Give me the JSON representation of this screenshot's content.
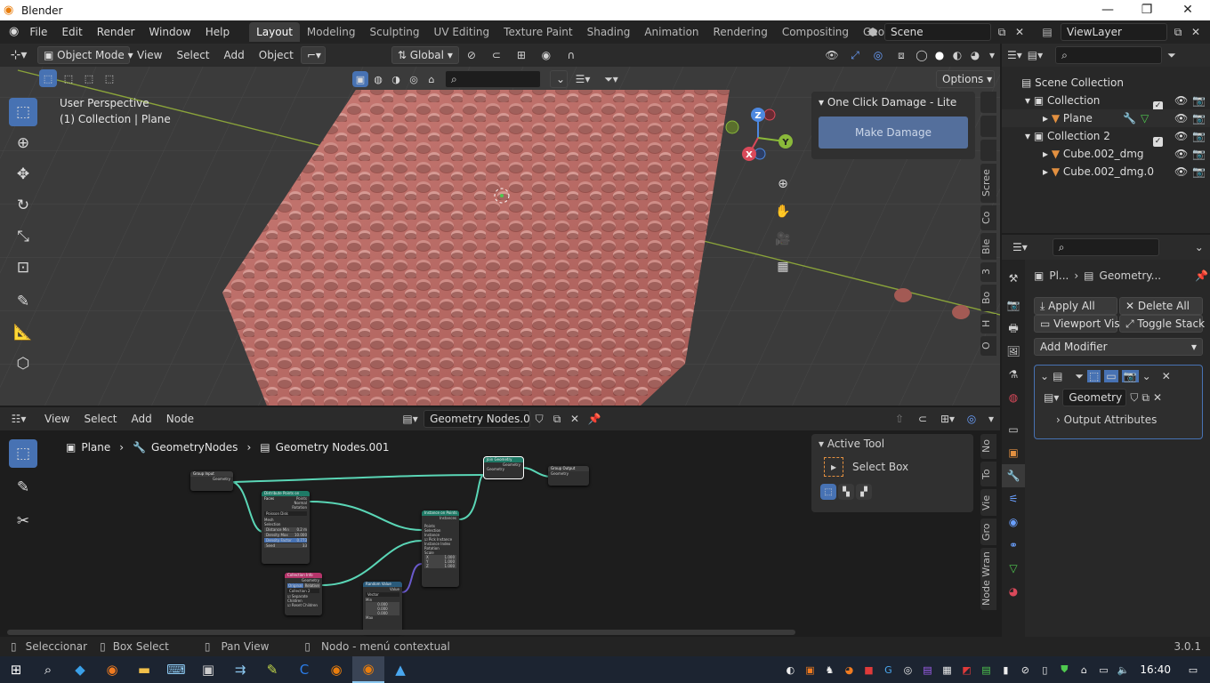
{
  "titlebar": {
    "title": "Blender",
    "minimize": "—",
    "maximize": "❐",
    "close": "✕"
  },
  "menu": [
    "File",
    "Edit",
    "Render",
    "Window",
    "Help"
  ],
  "workspaces": [
    "Layout",
    "Modeling",
    "Sculpting",
    "UV Editing",
    "Texture Paint",
    "Shading",
    "Animation",
    "Rendering",
    "Compositing",
    "Geometry No"
  ],
  "scene": "Scene",
  "view_layer": "ViewLayer",
  "viewport": {
    "mode": "Object Mode",
    "menus": [
      "View",
      "Select",
      "Add",
      "Object"
    ],
    "transform": "Global",
    "options": "Options",
    "overlay_title": "User Perspective",
    "overlay_sub": "(1) Collection | Plane",
    "gizmo": {
      "x": "X",
      "y": "Y",
      "z": "Z"
    },
    "side_tabs": [
      "Scree",
      "Co",
      "Ble",
      "3",
      "Bo",
      "H",
      "O"
    ],
    "panel_title": "One Click Damage - Lite",
    "panel_button": "Make Damage"
  },
  "outliner": {
    "root": "Scene Collection",
    "items": [
      {
        "label": "Collection",
        "level": 1
      },
      {
        "label": "Plane",
        "level": 2
      },
      {
        "label": "Collection 2",
        "level": 1
      },
      {
        "label": "Cube.002_dmg",
        "level": 2
      },
      {
        "label": "Cube.002_dmg.0",
        "level": 2
      }
    ]
  },
  "properties": {
    "breadcrumb_object": "Pl...",
    "breadcrumb_modifier": "Geometry...",
    "apply_all": "Apply All",
    "delete_all": "Delete All",
    "viewport_vis": "Viewport Vis",
    "toggle_stack": "Toggle Stack",
    "add_modifier": "Add Modifier",
    "node_group": "Geometry N...",
    "output_attributes": "Output Attributes"
  },
  "node_editor": {
    "menus": [
      "View",
      "Select",
      "Add",
      "Node"
    ],
    "tree_name": "Geometry Nodes.001",
    "breadcrumb": [
      "Plane",
      "GeometryNodes",
      "Geometry Nodes.001"
    ],
    "side_tabs": [
      "No",
      "To",
      "Vie",
      "Gro",
      "Node Wran"
    ],
    "active_tool_title": "Active Tool",
    "active_tool_name": "Select Box",
    "nodes": {
      "group_input": "Group Input",
      "distribute": "Distribute Points on Faces",
      "collection_info": "Collection Info",
      "random_value": "Random Value",
      "instance": "Instance on Points",
      "join": "Join Geometry",
      "group_output": "Group Output",
      "geometry": "Geometry",
      "points": "Points",
      "normal": "Normal",
      "rotation": "Rotation",
      "instances": "Instances",
      "value": "Value",
      "poisson": "Poisson Disk",
      "vector": "Vector",
      "mesh": "Mesh",
      "selection": "Selection",
      "distance_min": "Distance Min",
      "density_max": "Density Max",
      "density_factor": "Density Factor",
      "seed": "Seed",
      "pick_instance": "Pick Instance",
      "instance_index": "Instance Index",
      "scale": "Scale",
      "instance_label": "Instance",
      "original": "Original",
      "relative": "Relative",
      "collection": "Collection 2",
      "separate_children": "Separate Children",
      "reset_children": "Reset Children",
      "min": "Min",
      "max": "Max",
      "dmin": "0.2 m",
      "dmax": "10.000",
      "dfac": "0.773",
      "seed_v": "33",
      "s1": "1.000",
      "s2": "1.000",
      "s3": "1.000",
      "r1": "0.000",
      "r2": "0.000",
      "r3": "0.000",
      "ax_x": "X",
      "ax_y": "Y",
      "ax_z": "Z"
    }
  },
  "statusbar": {
    "select": "Seleccionar",
    "box_select": "Box Select",
    "pan": "Pan View",
    "context": "Nodo - menú contextual",
    "version": "3.0.1"
  },
  "taskbar": {
    "time": "16:40"
  }
}
